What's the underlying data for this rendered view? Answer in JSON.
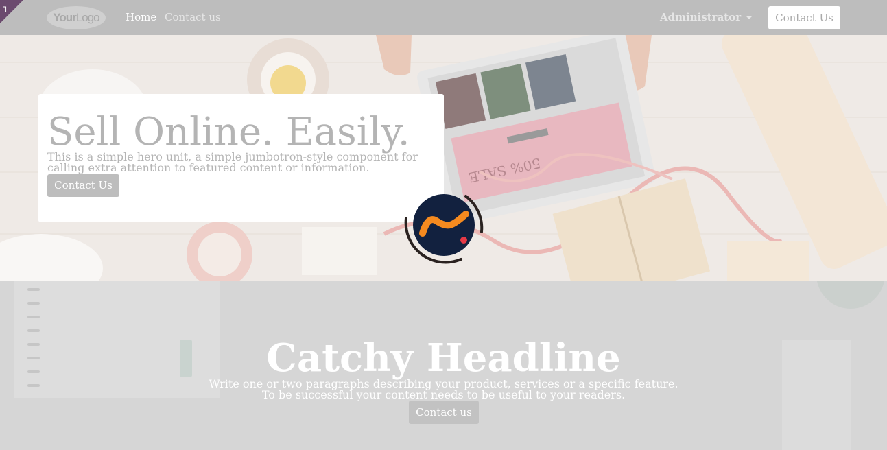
{
  "navbar": {
    "logo_main": "Your",
    "logo_tail": "Logo",
    "links": [
      {
        "label": "Home",
        "active": true
      },
      {
        "label": "Contact us",
        "active": false
      }
    ],
    "user_menu_label": "Administrator",
    "cta_label": "Contact Us"
  },
  "hero": {
    "title": "Sell Online. Easily.",
    "text": "This is a simple hero unit, a simple jumbotron-style component for calling extra attention to featured content or information.",
    "button_label": "Contact Us"
  },
  "section2": {
    "title": "Catchy Headline",
    "text_line1": "Write one or two paragraphs describing your product, services or a specific feature.",
    "text_line2": "To be successful your content needs to be useful to your readers.",
    "button_label": "Contact us"
  },
  "loader": {
    "icon": "app-logo-spinner-icon"
  },
  "colors": {
    "navbar_bg": "#bdbdbd",
    "badge": "#6b4a6e",
    "loader_bg": "#12213f",
    "loader_accent": "#f58a1f"
  },
  "icons": {
    "corner_badge": "corner-toggle-icon",
    "dropdown": "caret-down-icon"
  }
}
